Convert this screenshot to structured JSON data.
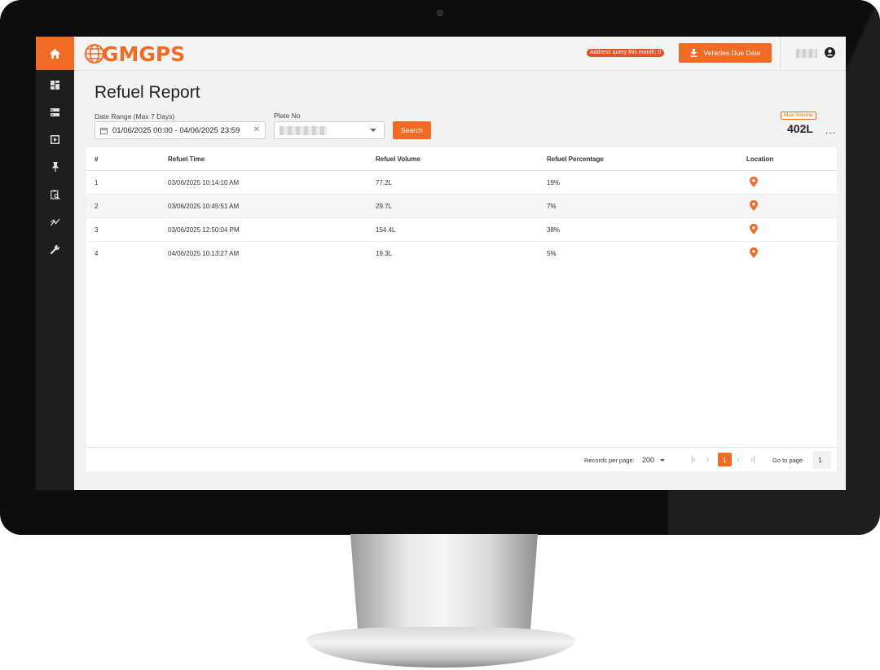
{
  "app": {
    "logo_text": "GMGPS",
    "accent_color": "#f26b25",
    "address_query_badge": "Address query this month: 0",
    "vehicles_due_button": "Vehicles Due Date",
    "user_menu_icon": "user-circle-icon"
  },
  "sidebar": {
    "items": [
      {
        "name": "home",
        "icon": "home-icon"
      },
      {
        "name": "dashboard",
        "icon": "dashboard-icon"
      },
      {
        "name": "list",
        "icon": "list-icon"
      },
      {
        "name": "playback",
        "icon": "playback-icon"
      },
      {
        "name": "pin",
        "icon": "pin-icon"
      },
      {
        "name": "report",
        "icon": "report-search-icon"
      },
      {
        "name": "analytics",
        "icon": "analytics-icon"
      },
      {
        "name": "tools",
        "icon": "wrench-icon"
      }
    ]
  },
  "page": {
    "title": "Refuel Report"
  },
  "filters": {
    "date_range_label": "Date Range (Max 7 Days)",
    "date_range_value": "01/06/2025 00:00 - 04/06/2025 23:59",
    "plate_label": "Plate No",
    "search_button": "Search"
  },
  "summary": {
    "max_volume_label": "Max Volume",
    "max_volume_value": "402L",
    "more": "..."
  },
  "table": {
    "headers": {
      "index": "#",
      "time": "Refuel Time",
      "volume": "Refuel Volume",
      "percentage": "Refuel Percentage",
      "location": "Location"
    },
    "rows": [
      {
        "index": "1",
        "time": "03/06/2025 10:14:10 AM",
        "volume": "77.2L",
        "percentage": "19%"
      },
      {
        "index": "2",
        "time": "03/06/2025 10:45:51 AM",
        "volume": "29.7L",
        "percentage": "7%"
      },
      {
        "index": "3",
        "time": "03/06/2025 12:50:04 PM",
        "volume": "154.4L",
        "percentage": "38%"
      },
      {
        "index": "4",
        "time": "04/06/2025 10:13:27 AM",
        "volume": "19.3L",
        "percentage": "5%"
      }
    ]
  },
  "pagination": {
    "records_per_page_label": "Records per page:",
    "records_per_page_value": "200",
    "current_page": "1",
    "goto_label": "Go to page",
    "goto_value": "1"
  }
}
